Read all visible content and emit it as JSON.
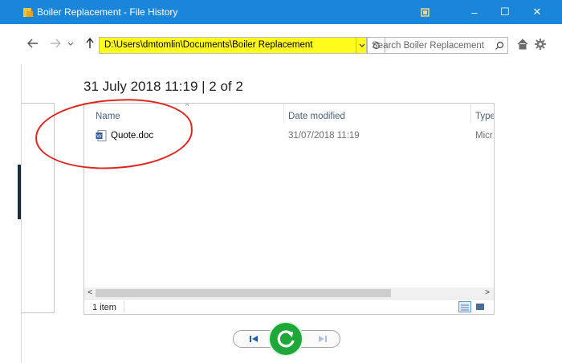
{
  "window": {
    "title": "Boiler Replacement - File History",
    "controls": {
      "minimize": "–",
      "maximize": "☐",
      "close": "✕"
    },
    "accent": "#1a86d9"
  },
  "nav": {
    "address": "D:\\Users\\dmtomlin\\Documents\\Boiler Replacement",
    "search_placeholder": "Search Boiler Replacement",
    "highlight_color": "#fffb1a"
  },
  "snapshot": {
    "title": "31 July 2018 11:19  |  2 of 2"
  },
  "file_list": {
    "columns": [
      "Name",
      "Date modified",
      "Type"
    ],
    "rows": [
      {
        "name": "Quote.doc",
        "date_modified": "31/07/2018 11:19",
        "type": "Micr"
      }
    ],
    "status": "1 item"
  },
  "annotation": {
    "color": "#e0261d"
  },
  "icons": {
    "app": "file-history-icon",
    "back": "back-arrow-icon",
    "forward": "forward-arrow-icon",
    "recent": "chevron-down-icon",
    "up": "up-arrow-icon",
    "refresh": "refresh-icon",
    "search": "search-icon",
    "home": "home-icon",
    "settings": "gear-icon",
    "restore": "restore-icon",
    "previous": "previous-version-icon",
    "next": "next-version-icon"
  },
  "restore_color": "#1fa83a"
}
